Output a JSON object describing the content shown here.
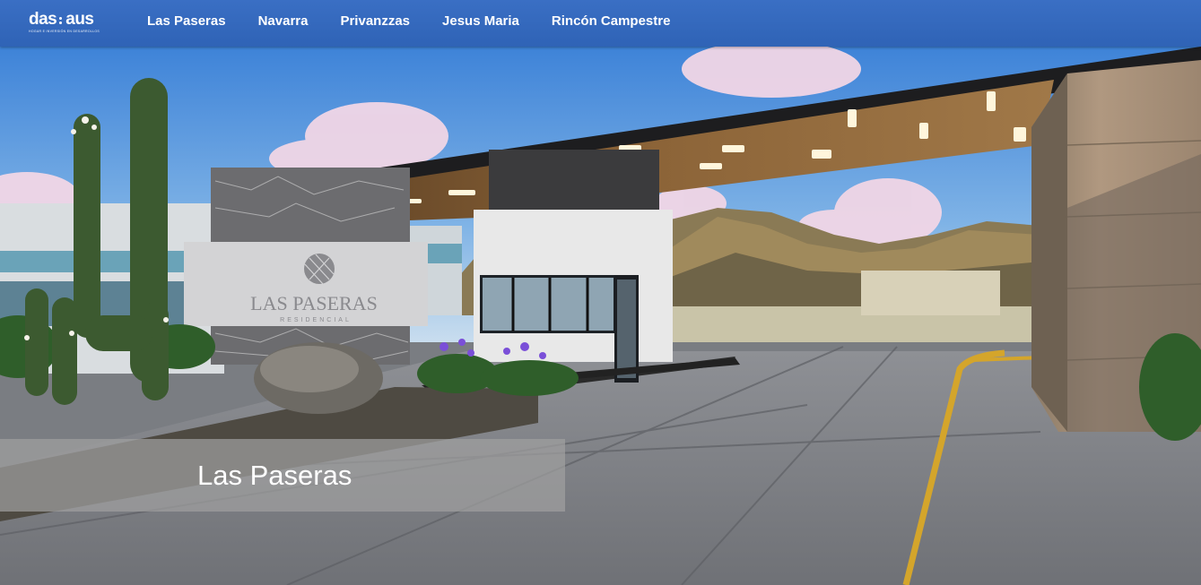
{
  "brand": {
    "name_left": "das",
    "name_right": "aus",
    "tagline": "HOGAR E INVERSIÓN EN DESARROLLOS"
  },
  "nav": {
    "items": [
      {
        "label": "Las Paseras"
      },
      {
        "label": "Navarra"
      },
      {
        "label": "Privanzzas"
      },
      {
        "label": "Jesus Maria"
      },
      {
        "label": "Rincón Campestre"
      }
    ]
  },
  "hero": {
    "caption": "Las Paseras",
    "sign_title": "LAS PASERAS",
    "sign_subtitle": "RESIDENCIAL"
  },
  "colors": {
    "nav_bg": "#3266bb",
    "road_line": "#d4a52b",
    "caption_bg": "#a0a0a0"
  }
}
